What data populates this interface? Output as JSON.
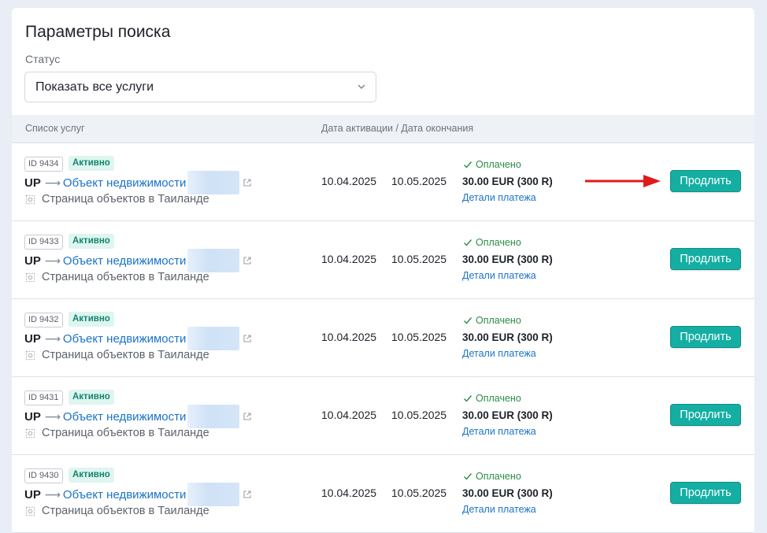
{
  "search": {
    "title": "Параметры поиска",
    "status_label": "Статус",
    "status_value": "Показать все услуги"
  },
  "table": {
    "col_services": "Список услуг",
    "col_dates": "Дата активации / Дата окончания"
  },
  "rows": [
    {
      "id": "ID 9434",
      "status": "Активно",
      "service_prefix": "UP",
      "service_link": "Объект недвижимости",
      "page": "Страница объектов в Таиланде",
      "activation": "10.04.2025",
      "expiry": "10.05.2025",
      "paid": "Оплачено",
      "amount": "30.00 EUR (300 R)",
      "details": "Детали платежа",
      "button": "Продлить"
    },
    {
      "id": "ID 9433",
      "status": "Активно",
      "service_prefix": "UP",
      "service_link": "Объект недвижимости",
      "page": "Страница объектов в Таиланде",
      "activation": "10.04.2025",
      "expiry": "10.05.2025",
      "paid": "Оплачено",
      "amount": "30.00 EUR (300 R)",
      "details": "Детали платежа",
      "button": "Продлить"
    },
    {
      "id": "ID 9432",
      "status": "Активно",
      "service_prefix": "UP",
      "service_link": "Объект недвижимости",
      "page": "Страница объектов в Таиланде",
      "activation": "10.04.2025",
      "expiry": "10.05.2025",
      "paid": "Оплачено",
      "amount": "30.00 EUR (300 R)",
      "details": "Детали платежа",
      "button": "Продлить"
    },
    {
      "id": "ID 9431",
      "status": "Активно",
      "service_prefix": "UP",
      "service_link": "Объект недвижимости",
      "page": "Страница объектов в Таиланде",
      "activation": "10.04.2025",
      "expiry": "10.05.2025",
      "paid": "Оплачено",
      "amount": "30.00 EUR (300 R)",
      "details": "Детали платежа",
      "button": "Продлить"
    },
    {
      "id": "ID 9430",
      "status": "Активно",
      "service_prefix": "UP",
      "service_link": "Объект недвижимости",
      "page": "Страница объектов в Таиланде",
      "activation": "10.04.2025",
      "expiry": "10.05.2025",
      "paid": "Оплачено",
      "amount": "30.00 EUR (300 R)",
      "details": "Детали платежа",
      "button": "Продлить"
    }
  ],
  "icons": {
    "dropdown": "chevron-down-icon",
    "external": "external-link-icon",
    "page": "gear-icon",
    "paid": "check-icon",
    "annotation": "red-arrow-icon"
  },
  "colors": {
    "accent": "#15aea3",
    "link": "#1a73c8",
    "active_badge_bg": "#dff5ef",
    "active_badge_text": "#11866f",
    "paid": "#2c8a45",
    "annotation": "#e01a1a"
  }
}
